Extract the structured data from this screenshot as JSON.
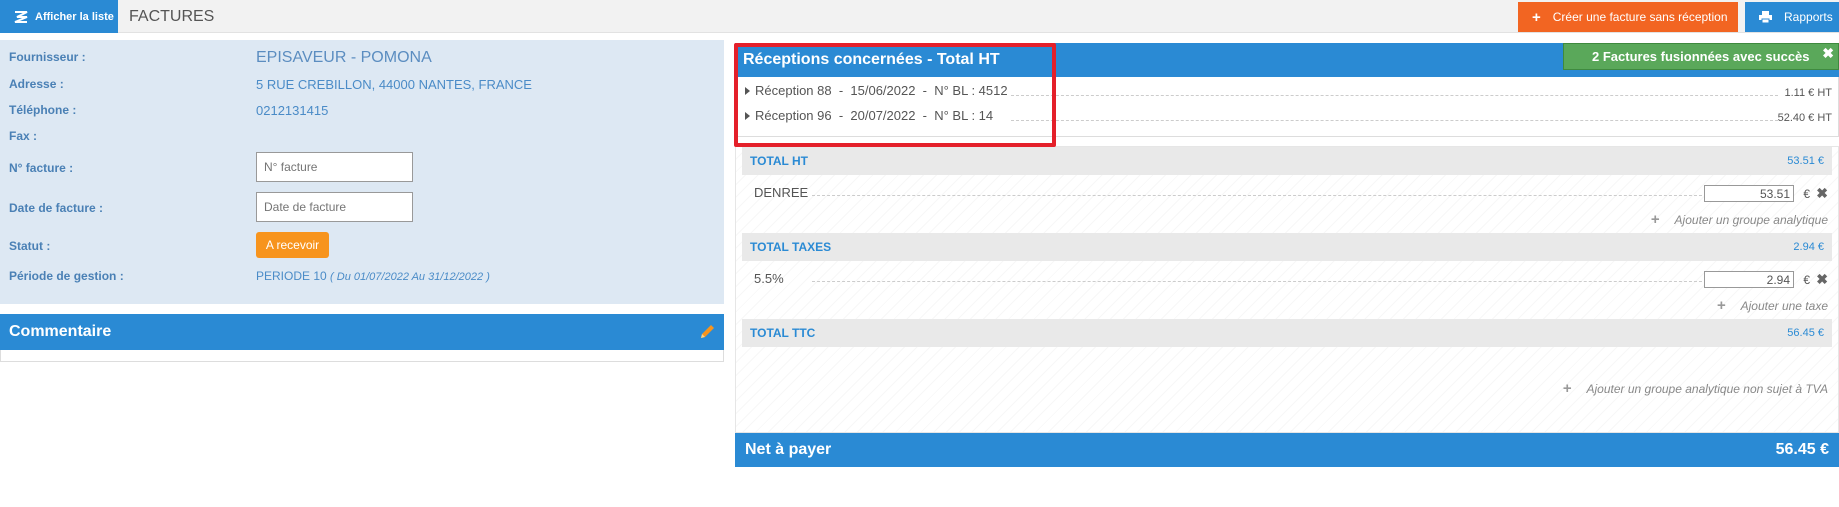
{
  "topbar": {
    "list_button": "Afficher la liste",
    "title": "FACTURES",
    "create_button": "Créer une facture sans réception",
    "reports_button": "Rapports"
  },
  "supplier": {
    "label_supplier": "Fournisseur :",
    "supplier": "EPISAVEUR - POMONA",
    "label_address": "Adresse :",
    "address": "5 RUE CREBILLON, 44000 NANTES, FRANCE",
    "label_phone": "Téléphone :",
    "phone": "0212131415",
    "label_fax": "Fax :",
    "label_invoice_no": "N° facture :",
    "invoice_no_placeholder": "N° facture",
    "label_invoice_date": "Date de facture :",
    "invoice_date_placeholder": "Date de facture",
    "label_status": "Statut :",
    "status": "A recevoir",
    "label_period": "Période de gestion :",
    "period": "PERIODE 10",
    "period_range": "( Du 01/07/2022 Au 31/12/2022 )"
  },
  "comment": {
    "title": "Commentaire"
  },
  "receptions": {
    "title": "Réceptions concernées - Total HT",
    "success_message": "2 Factures fusionnées avec succès",
    "items": [
      {
        "label": "Réception 88  -  15/06/2022  -  N° BL : 4512",
        "amount": "1.11 € HT"
      },
      {
        "label": "Réception 96  -  20/07/2022  -  N° BL : 14",
        "amount": "52.40 € HT"
      }
    ]
  },
  "totals": {
    "ht_label": "TOTAL HT",
    "ht_value": "53.51 €",
    "denree_label": "DENREE",
    "denree_value": "53.51",
    "add_analytic_group": "Ajouter un groupe analytique",
    "taxes_label": "TOTAL TAXES",
    "taxes_value": "2.94 €",
    "tax_rate_label": "5.5%",
    "tax_rate_value": "2.94",
    "add_tax": "Ajouter une taxe",
    "ttc_label": "TOTAL TTC",
    "ttc_value": "56.45 €",
    "add_analytic_group_no_vat": "Ajouter un groupe analytique non sujet à TVA",
    "currency": "€"
  },
  "net": {
    "label": "Net à payer",
    "value": "56.45 €"
  },
  "colors": {
    "accent_blue": "#2a8ad4",
    "orange": "#f26522",
    "status_orange": "#f7941d",
    "success_green": "#5aa85a",
    "highlight_red": "#e4202a"
  }
}
